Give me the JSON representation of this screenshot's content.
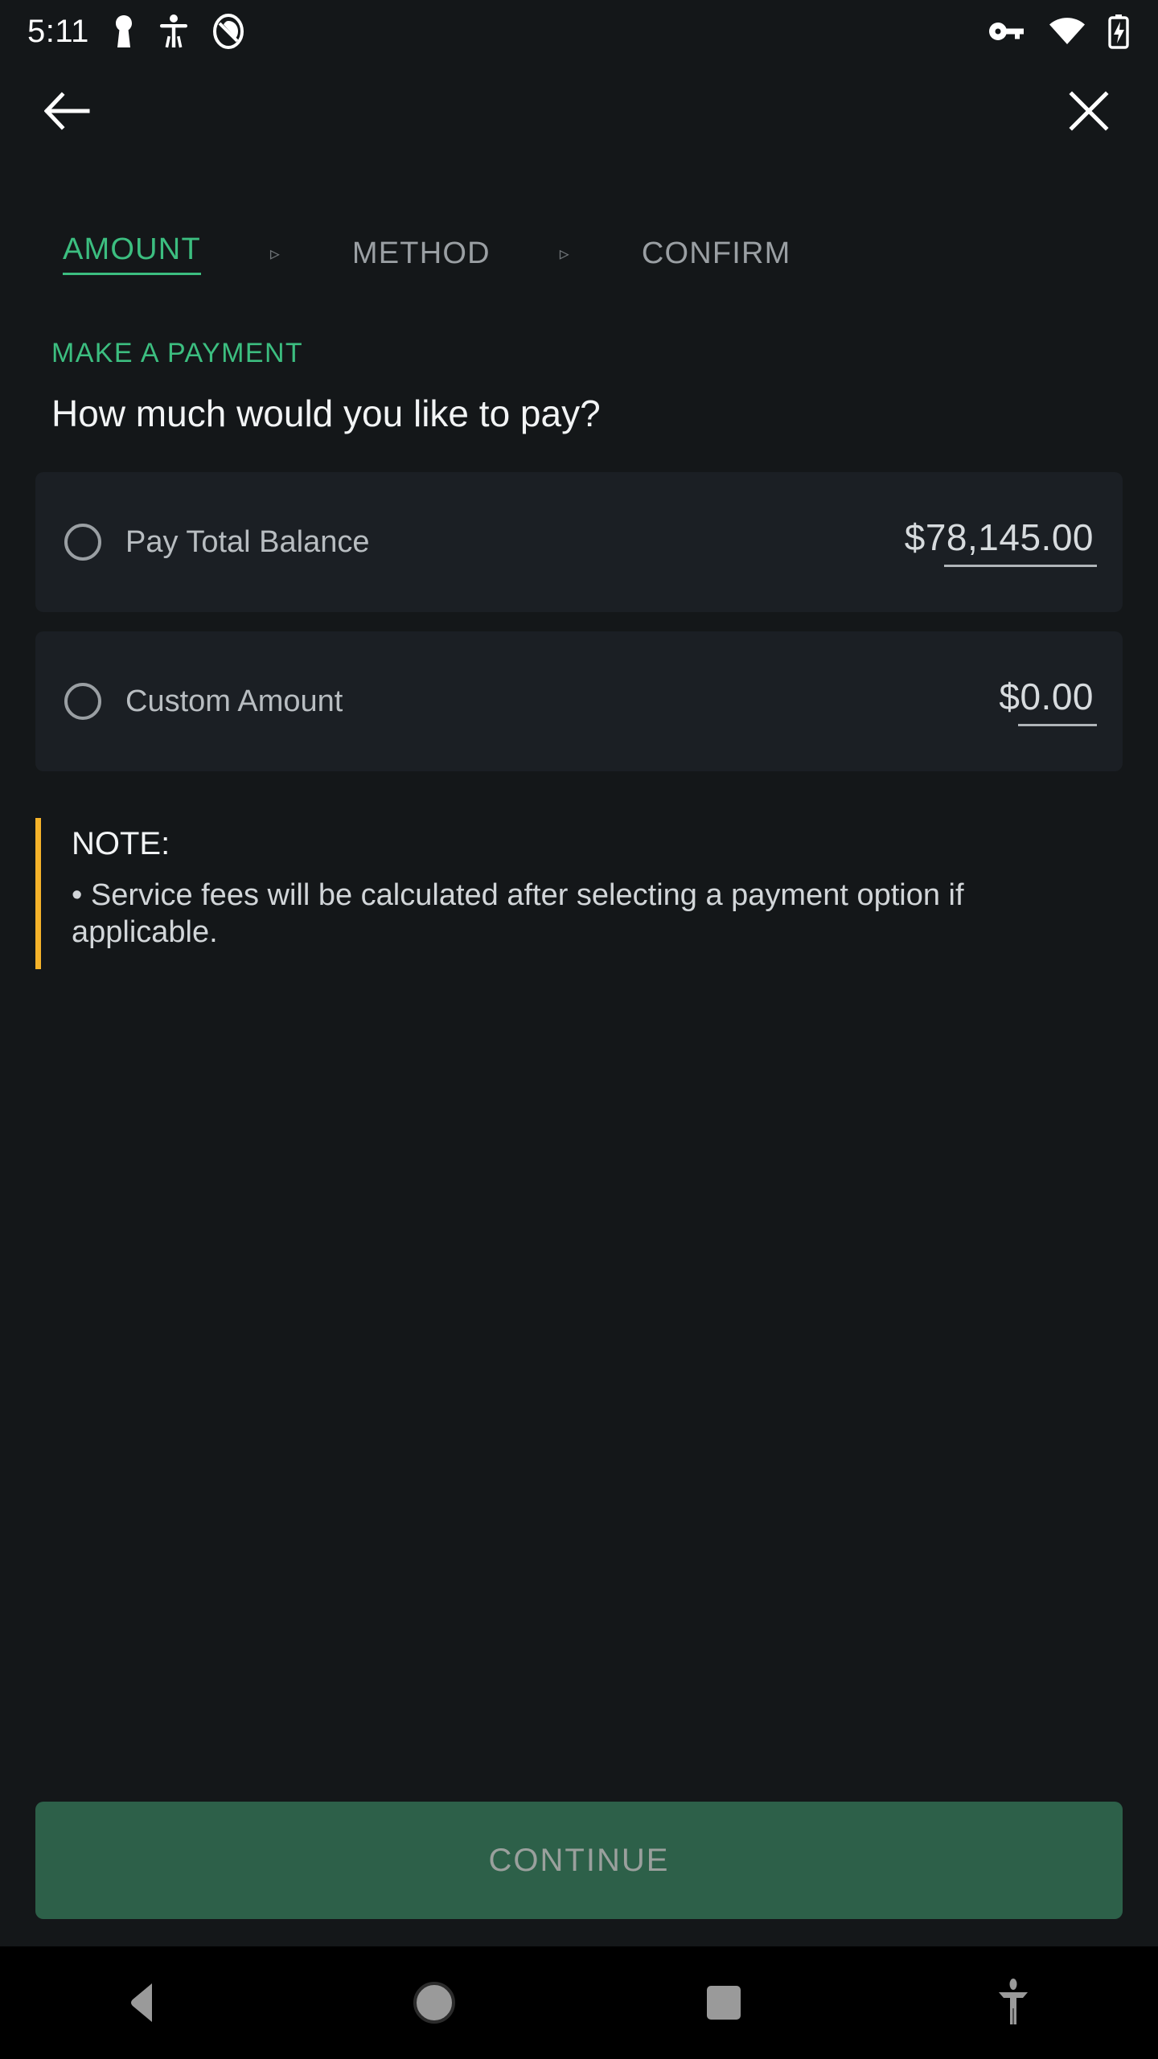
{
  "statusbar": {
    "time": "5:11",
    "left_icons": [
      "keyhole-icon",
      "accessibility-icon",
      "do-not-disturb-icon"
    ],
    "right_icons": [
      "vpn-key-icon",
      "wifi-icon",
      "battery-charging-icon"
    ]
  },
  "appbar": {
    "back_label": "Back",
    "close_label": "Close"
  },
  "stepper": {
    "separator": "▹",
    "steps": [
      {
        "label": "AMOUNT",
        "state": "active"
      },
      {
        "label": "METHOD",
        "state": "inactive"
      },
      {
        "label": "CONFIRM",
        "state": "inactive"
      }
    ]
  },
  "main": {
    "eyebrow": "MAKE A PAYMENT",
    "headline": "How much would you like to pay?",
    "options": [
      {
        "label": "Pay Total Balance",
        "amount": "$78,145.00",
        "selected": false
      },
      {
        "label": "Custom Amount",
        "amount": "$0.00",
        "selected": false
      }
    ]
  },
  "note": {
    "title": "NOTE:",
    "body": "• Service fees will be calculated after selecting a payment option if applicable."
  },
  "footer": {
    "continue_label": "CONTINUE"
  },
  "navbar": {
    "back": "back-triangle-icon",
    "home": "home-circle-icon",
    "recents": "recents-square-icon",
    "accessibility": "accessibility-icon"
  },
  "colors": {
    "page_bg": "#141719",
    "card_bg": "#1b1f24",
    "accent_green": "#3cbe80",
    "button_green": "#2d6049",
    "note_amber": "#f5b32a",
    "text_primary": "#f2f4f5",
    "text_secondary": "#b8bdc1"
  }
}
